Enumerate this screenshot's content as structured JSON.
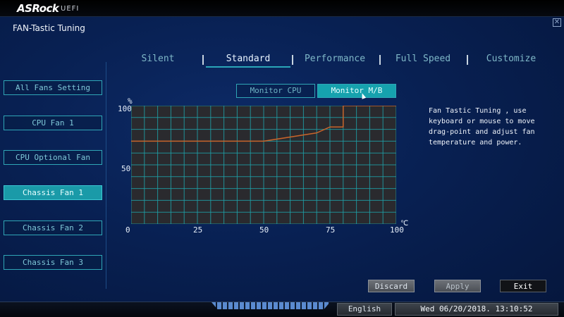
{
  "header": {
    "brand": "ASRock",
    "brand_sub": "UEFI",
    "close_glyph": "✕"
  },
  "page_title": "FAN-Tastic Tuning",
  "tabs": [
    {
      "label": "Silent",
      "active": false
    },
    {
      "label": "Standard",
      "active": true
    },
    {
      "label": "Performance",
      "active": false
    },
    {
      "label": "Full Speed",
      "active": false
    },
    {
      "label": "Customize",
      "active": false
    }
  ],
  "fans": [
    {
      "label": "All Fans Setting",
      "active": false
    },
    {
      "label": "CPU Fan 1",
      "active": false
    },
    {
      "label": "CPU Optional Fan",
      "active": false
    },
    {
      "label": "Chassis Fan 1",
      "active": true
    },
    {
      "label": "Chassis Fan 2",
      "active": false
    },
    {
      "label": "Chassis Fan 3",
      "active": false
    }
  ],
  "monitor": {
    "cpu_label": "Monitor CPU",
    "mb_label": "Monitor M/B",
    "selected": "Monitor M/B"
  },
  "chart_data": {
    "type": "line",
    "x": [
      0,
      50,
      70,
      75,
      80,
      80,
      100
    ],
    "y": [
      70,
      70,
      77,
      82,
      82,
      100,
      100
    ],
    "xlim": [
      0,
      100
    ],
    "ylim": [
      0,
      100
    ],
    "x_ticks": [
      "0",
      "25",
      "50",
      "75",
      "100"
    ],
    "y_ticks": [
      "100",
      "50"
    ],
    "ylabel": "%",
    "xlabel": "℃",
    "grid": true,
    "line_color": "#c8642a",
    "grid_color": "#1fa0a8",
    "background": "#2a2a2e"
  },
  "help_text": "Fan Tastic Tuning , use keyboard or mouse to move drag-point and adjust fan temperature and power.",
  "actions": {
    "discard": "Discard",
    "apply": "Apply",
    "exit": "Exit"
  },
  "footer": {
    "language": "English",
    "datetime": "Wed 06/20/2018. 13:10:52"
  }
}
